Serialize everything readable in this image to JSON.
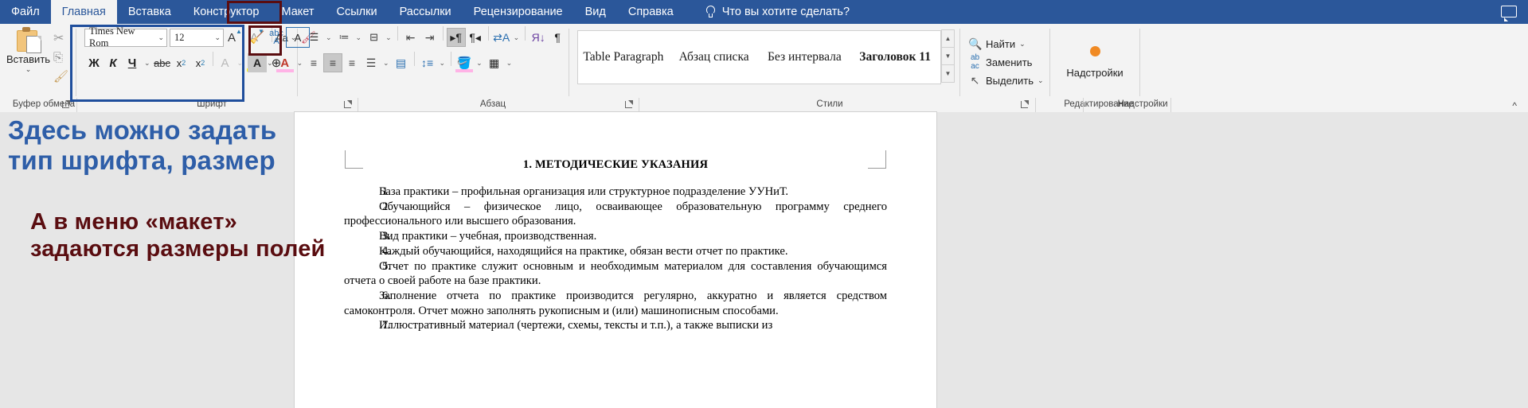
{
  "tabs": [
    {
      "label": "Файл",
      "active": false
    },
    {
      "label": "Главная",
      "active": true
    },
    {
      "label": "Вставка",
      "active": false
    },
    {
      "label": "Конструктор",
      "active": false
    },
    {
      "label": "Макет",
      "active": false
    },
    {
      "label": "Ссылки",
      "active": false
    },
    {
      "label": "Рассылки",
      "active": false
    },
    {
      "label": "Рецензирование",
      "active": false
    },
    {
      "label": "Вид",
      "active": false
    },
    {
      "label": "Справка",
      "active": false
    }
  ],
  "tell_me": {
    "label": "Что вы хотите сделать?",
    "icon": "lightbulb-icon"
  },
  "comment_icon": "comment-icon",
  "clipboard": {
    "group_label": "Буфер обмена",
    "paste_label": "Вставить",
    "cut_icon": "scissors-icon",
    "copy_icon": "copy-icon",
    "format_painter_icon": "format-painter-icon"
  },
  "font": {
    "group_label": "Шрифт",
    "font_name": "Times New Rom",
    "font_size": "12",
    "grow_label": "A",
    "shrink_label": "A",
    "change_case_label": "Aa",
    "clear_format_icon": "clear-formatting-icon",
    "bold": "Ж",
    "italic": "К",
    "underline": "Ч",
    "strikethrough": "abc",
    "subscript": "x",
    "subscript_sub": "2",
    "superscript": "x",
    "superscript_sup": "2",
    "text_effects": "A",
    "highlight": "ab",
    "font_color": "A",
    "phonetic": "abc",
    "char_border": "A",
    "char_shading": "A",
    "enclose_char": "字"
  },
  "paragraph": {
    "group_label": "Абзац",
    "bullets_icon": "bulleted-list-icon",
    "numbering_icon": "numbered-list-icon",
    "multilevel_icon": "multilevel-list-icon",
    "decrease_indent_icon": "decrease-indent-icon",
    "increase_indent_icon": "increase-indent-icon",
    "sort_icon": "sort-icon",
    "show_marks_icon": "show-formatting-marks-icon",
    "align_left_icon": "align-left-icon",
    "align_center_icon": "align-center-icon",
    "align_right_icon": "align-right-icon",
    "justify_icon": "justify-icon",
    "line_spacing_icon": "line-spacing-icon",
    "shading_icon": "shading-icon",
    "borders_icon": "borders-icon",
    "ltr_icon": "left-to-right-icon",
    "rtl_icon": "right-to-left-icon",
    "pilcrow": "¶"
  },
  "styles": {
    "group_label": "Стили",
    "items": [
      {
        "name": "Table Paragraph",
        "heading": false
      },
      {
        "name": "Абзац списка",
        "heading": false
      },
      {
        "name": "Без интервала",
        "heading": false
      },
      {
        "name": "Заголовок 11",
        "heading": true
      }
    ],
    "scroll_up": "▲",
    "scroll_down": "▼",
    "more": "▼"
  },
  "editing": {
    "group_label": "Редактирование",
    "find": "Найти",
    "replace": "Заменить",
    "select": "Выделить",
    "find_icon": "search-icon",
    "replace_icon": "replace-icon",
    "select_icon": "cursor-select-icon"
  },
  "addins": {
    "group_label": "Надстройки",
    "label": "Надстройки",
    "icon": "addins-dot-icon"
  },
  "ribbon_collapse": "^",
  "annotations": {
    "blue_text": "Здесь можно задать\nтип шрифта, размер",
    "blue_color": "#2e5ea8",
    "red_text": "А в меню «макет»\nзадаются размеры полей",
    "red_color": "#5a0d10"
  },
  "document": {
    "title": "1. МЕТОДИЧЕСКИЕ УКАЗАНИЯ",
    "paragraphs": [
      {
        "num": "1.",
        "text": "База практики – профильная организация или структурное подразделение УУНиТ."
      },
      {
        "num": "2.",
        "text": "Обучающийся – физическое лицо, осваивающее образовательную программу среднего профессионального или высшего образования."
      },
      {
        "num": "3.",
        "text": "Вид практики – учебная, производственная."
      },
      {
        "num": "4.",
        "text": "Каждый обучающийся, находящийся на практике, обязан вести отчет по практике."
      },
      {
        "num": "5.",
        "text": "Отчет по практике служит основным и необходимым материалом для составления обучающимся отчета о своей работе на базе практики."
      },
      {
        "num": "6.",
        "text": "Заполнение отчета по практике производится регулярно, аккуратно и является средством самоконтроля. Отчет можно заполнять рукописным и (или) машинописным способами."
      },
      {
        "num": "7.",
        "text": "Иллюстративный материал (чертежи, схемы, тексты и т.п.), а также выписки из"
      }
    ]
  }
}
